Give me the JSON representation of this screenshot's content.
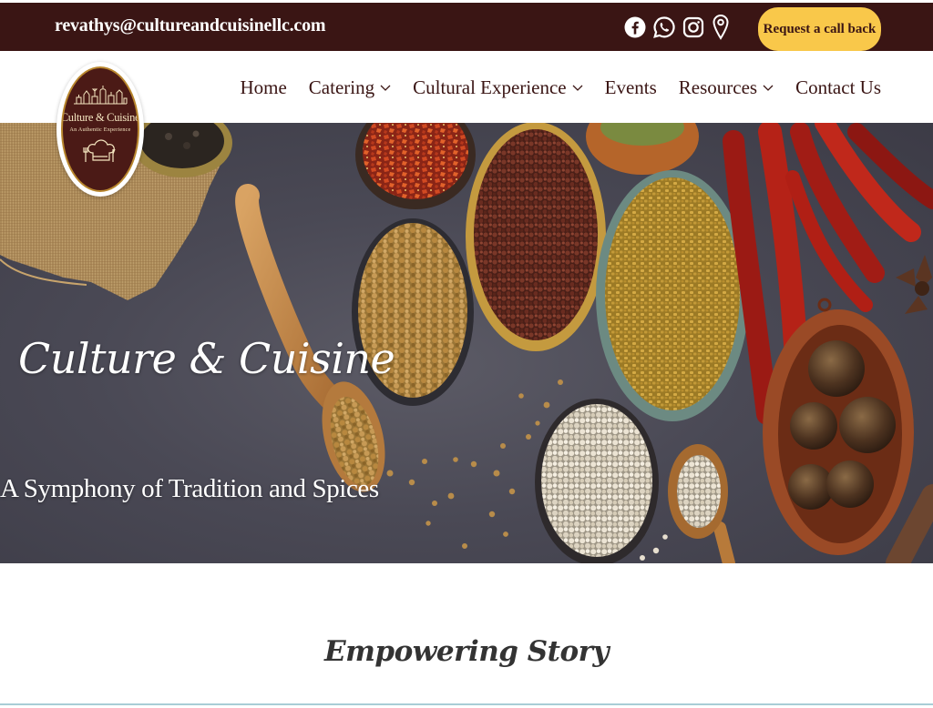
{
  "topbar": {
    "email": "revathys@cultureandcuisinellc.com",
    "social_icons": [
      "facebook-icon",
      "whatsapp-icon",
      "instagram-icon",
      "map-pin-icon"
    ],
    "callback_label": "Request a call back"
  },
  "logo": {
    "title": "Culture & Cuisine",
    "tagline": "An Authentic Experience"
  },
  "nav": {
    "items": [
      {
        "label": "Home",
        "has_dropdown": false
      },
      {
        "label": "Catering",
        "has_dropdown": true
      },
      {
        "label": "Cultural Experience",
        "has_dropdown": true
      },
      {
        "label": "Events",
        "has_dropdown": false
      },
      {
        "label": "Resources",
        "has_dropdown": true
      },
      {
        "label": "Contact Us",
        "has_dropdown": false
      }
    ]
  },
  "hero": {
    "title": "Culture & Cuisine",
    "subtitle": "A Symphony of Tradition and Spices"
  },
  "story": {
    "title": "Empowering Story"
  },
  "colors": {
    "brand_dark": "#3a1514",
    "accent_yellow": "#f9c84a",
    "logo_gold": "#b8862d"
  }
}
